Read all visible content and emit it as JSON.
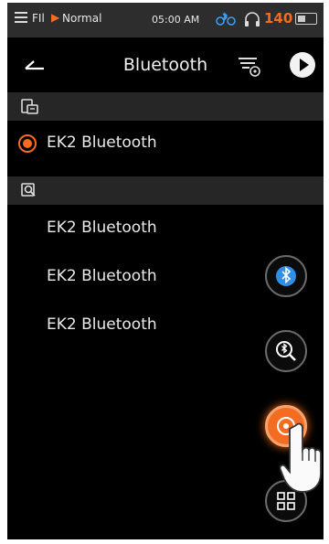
{
  "status_bar": {
    "source": "FIl",
    "mode": "Normal",
    "time": "05:00 AM",
    "volume": "140",
    "accent_color": "#f36c21"
  },
  "header": {
    "title": "Bluetooth",
    "icons": [
      "back-icon",
      "filter-settings-icon",
      "play-icon"
    ]
  },
  "paired_section": {
    "icon": "paired-devices-icon",
    "devices": [
      {
        "label": "EK2 Bluetooth",
        "selected": true
      }
    ]
  },
  "search_section": {
    "icon": "search-devices-icon",
    "devices": [
      {
        "label": "EK2 Bluetooth"
      },
      {
        "label": "EK2 Bluetooth"
      },
      {
        "label": "EK2 Bluetooth"
      }
    ]
  },
  "floating_buttons": [
    "bluetooth-toggle-icon",
    "bluetooth-search-icon",
    "settings-icon",
    "grid-icon"
  ]
}
